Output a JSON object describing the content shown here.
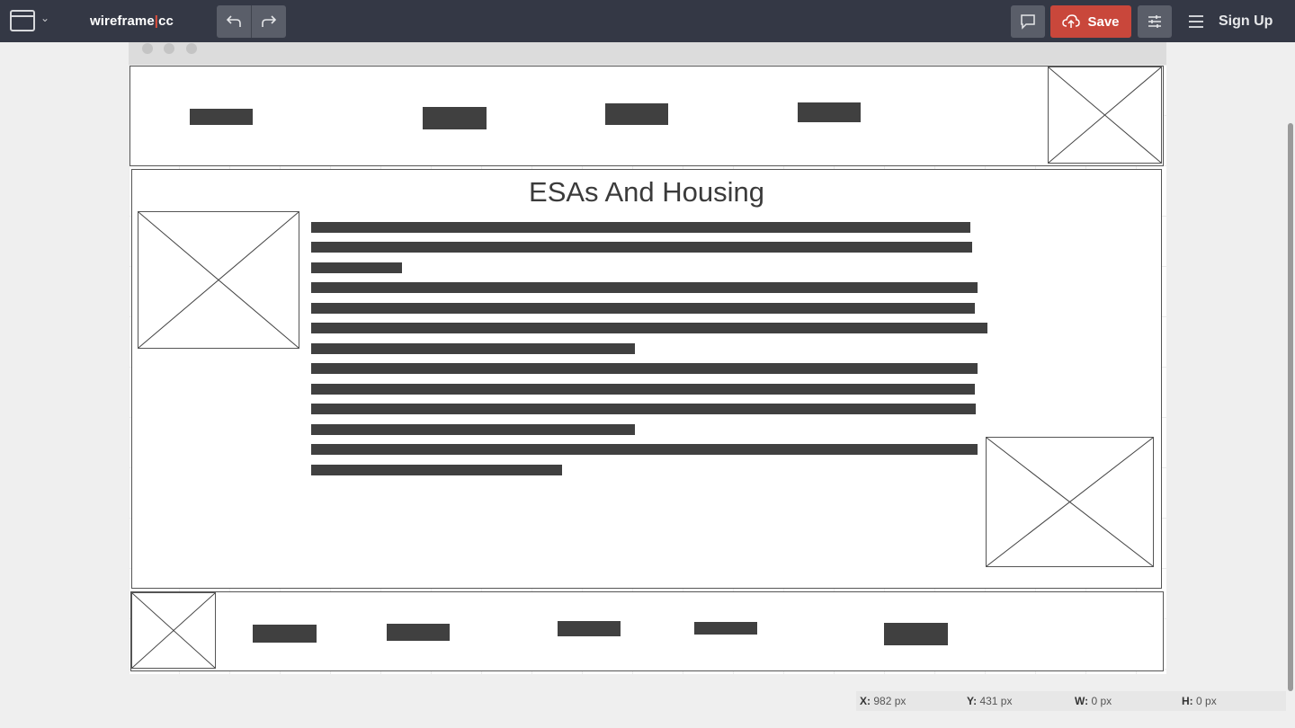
{
  "app": {
    "logo_main": "wireframe",
    "logo_sep": "|",
    "logo_suffix": "cc",
    "save_label": "Save",
    "signup_label": "Sign Up",
    "accent_color": "#c9473b",
    "toolbar_color": "#343845"
  },
  "icons": {
    "window": "window-icon",
    "undo": "undo-icon",
    "redo": "redo-icon",
    "comment": "comment-icon",
    "cloud_upload": "cloud-upload-icon",
    "settings": "sliders-icon",
    "menu": "hamburger-menu-icon"
  },
  "canvas": {
    "page_title": "ESAs And Housing"
  },
  "status": {
    "x_label": "X:",
    "x_value": "982 px",
    "y_label": "Y:",
    "y_value": "431 px",
    "w_label": "W:",
    "w_value": "0 px",
    "h_label": "H:",
    "h_value": "0 px"
  }
}
